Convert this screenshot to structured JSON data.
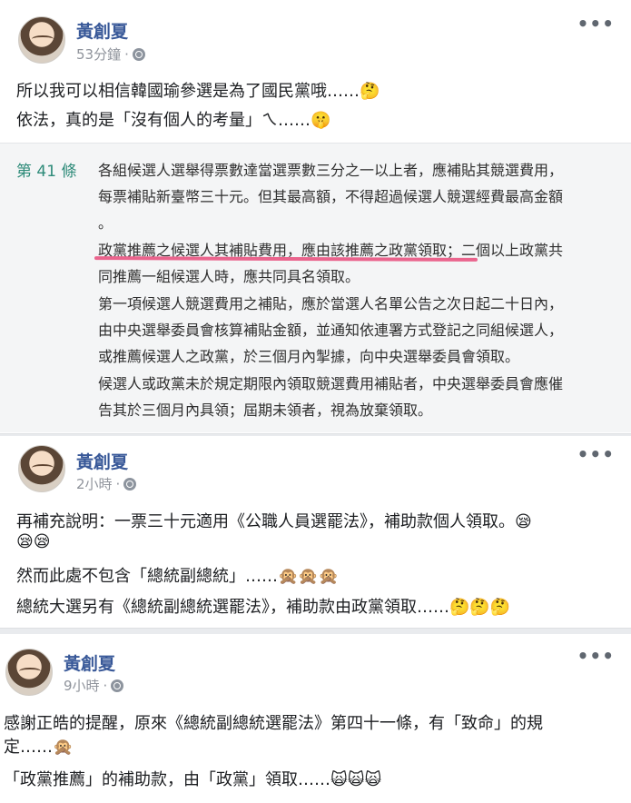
{
  "posts": [
    {
      "author": "黃創夏",
      "timestamp": "53分鐘",
      "more_icon": "more-horizontal-icon",
      "lines": [
        "所以我可以相信韓國瑜參選是為了國民黨哦……🤔",
        "依法，真的是「沒有個人的考量」ㄟ……🤫"
      ],
      "law": {
        "article": "第 41 條",
        "lines": [
          "各組候選人選舉得票數達當選票數三分之一以上者，應補貼其競選費用，",
          "每票補貼新臺幣三十元。但其最高額，不得超過候選人競選經費最高金額",
          "。",
          "政黨推薦之候選人其補貼費用，應由該推薦之政黨領取；二個以上政黨共",
          "同推薦一組候選人時，應共同具名領取。",
          "第一項候選人競選費用之補貼，應於當選人名單公告之次日起二十日內，",
          "由中央選舉委員會核算補貼金額，並通知依連署方式登記之同組候選人，",
          "或推薦候選人之政黨，於三個月內掣據，向中央選舉委員會領取。",
          "候選人或政黨未於規定期限內領取競選費用補貼者，中央選舉委員會應催",
          "告其於三個月內具領；屆期未領者，視為放棄領取。"
        ],
        "highlight_color": "#e84a7a"
      }
    },
    {
      "author": "黃創夏",
      "timestamp": "2小時",
      "lines": [
        "再補充說明：一票三十元適用《公職人員選罷法》，補助款個人領取。😪",
        "😪😪",
        "然而此處不包含「總統副總統」……🙊🙊🙊",
        "總統大選另有《總統副總統選罷法》，補助款由政黨領取……🤔🤔🤔"
      ]
    },
    {
      "author": "黃創夏",
      "timestamp": "9小時",
      "lines": [
        "感謝正皓的提醒，原來《總統副總統選罷法》第四十一條，有「致命」的規",
        "定……🙊",
        "「政黨推薦」的補助款，由「政黨」領取……🙀🙀🙀"
      ]
    }
  ],
  "colors": {
    "author": "#385898",
    "article_label": "#2e8b79",
    "meta": "#90949c"
  }
}
